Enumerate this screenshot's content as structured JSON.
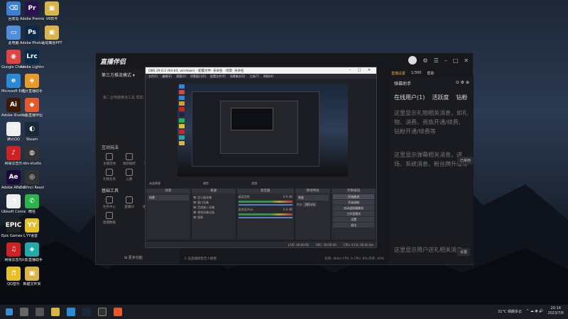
{
  "desktop": {
    "icons": [
      {
        "label": "回收站",
        "color": "#3d7fd1",
        "glyph": "⌫"
      },
      {
        "label": "Adobe Premie...",
        "color": "#2a1150",
        "glyph": "Pr"
      },
      {
        "label": "V6软件",
        "color": "#d9b44a",
        "glyph": "▣"
      },
      {
        "label": "此电脑",
        "color": "#4f8cd9",
        "glyph": "▭"
      },
      {
        "label": "Adobe Photosh...",
        "color": "#0a2a47",
        "glyph": "Ps"
      },
      {
        "label": "活动策划PPT",
        "color": "#d9b44a",
        "glyph": "▣"
      },
      {
        "label": "Google Chrome",
        "color": "#d44",
        "glyph": "◉"
      },
      {
        "label": "Adobe Lightro...",
        "color": "#0a2a47",
        "glyph": "Lrc"
      },
      {
        "label": "Microsoft Edge",
        "color": "#2a8ad4",
        "glyph": "e"
      },
      {
        "label": "虎牙直播助手",
        "color": "#e59a2a",
        "glyph": "◈"
      },
      {
        "label": "Adobe Illustrat...",
        "color": "#3a1a05",
        "glyph": "Ai"
      },
      {
        "label": "斗鱼直播伴侣",
        "color": "#e55a2a",
        "glyph": "◆"
      },
      {
        "label": "腾讯QQ",
        "color": "#eee",
        "glyph": "☺"
      },
      {
        "label": "Steam",
        "color": "#1b2838",
        "glyph": "◐"
      },
      {
        "label": "网易云音乐",
        "color": "#c22",
        "glyph": "♪"
      },
      {
        "label": "obs-studio",
        "color": "#333",
        "glyph": "◍"
      },
      {
        "label": "Adobe After Effects CC",
        "color": "#1a0a3a",
        "glyph": "Ae"
      },
      {
        "label": "DaVinci Resolve",
        "color": "#333",
        "glyph": "◎"
      },
      {
        "label": "Ubisoft Connect",
        "color": "#eee",
        "glyph": "◔"
      },
      {
        "label": "微信",
        "color": "#2bb34a",
        "glyph": "✆"
      },
      {
        "label": "Epic Games Launcher",
        "color": "#222",
        "glyph": "EPIC"
      },
      {
        "label": "YY语音",
        "color": "#e5c02a",
        "glyph": "YY"
      },
      {
        "label": "网易云音乐",
        "color": "#c22",
        "glyph": "♫"
      },
      {
        "label": "火影直播助手",
        "color": "#2aa",
        "glyph": "◈"
      },
      {
        "label": "QQ音乐",
        "color": "#e5c02a",
        "glyph": "♬"
      },
      {
        "label": "新建文件夹",
        "color": "#d9b44a",
        "glyph": "▣"
      }
    ]
  },
  "app": {
    "logo": "直播伴侣",
    "mode_label": "第三方推流模式 ▾",
    "left_note": "第二台电脑推流工具 帮助...",
    "top_links": [
      "直播设置",
      "1/300",
      "帮助"
    ],
    "section_interact": "互动玩法",
    "interact_tools": [
      "主播连线",
      "福袋抽奖",
      "粉丝团",
      "礼物任务",
      "心愿",
      "红包"
    ],
    "section_basic": "基础工具",
    "basic_tools": [
      "任务中心",
      "直播间",
      "弹幕助手",
      "直播数据"
    ],
    "more_label": "更多功能",
    "status_left": "① 该直播間暂无人觀看",
    "status_right": [
      "码率: 0kb/s",
      "FPS: 0",
      "CPU: 8%",
      "内存: 40%"
    ]
  },
  "right_panel": {
    "title": "弹幕助手",
    "tabs": [
      "在线用户(1)",
      "活跃度",
      "钻粉"
    ],
    "msg1": "这里显示礼物相关消息，如礼物、消费、贵族开通/续费、钻粉开通/续费等",
    "msg2": "这里显示弹幕相关消息，进场、系统消息、粉丝牌升级等",
    "msg3": "这里显示用户送礼相关消息",
    "chip1": "已禁用",
    "chip2": "设置"
  },
  "obs": {
    "title": "OBS 29.0.2 (64-bit, windows) - 配置文件: 未命名 - 场景: 未命名",
    "menu": [
      "文件(F)",
      "编辑(E)",
      "视图(V)",
      "停靠窗口(D)",
      "配置文件(P)",
      "场景集合(S)",
      "工具(T)",
      "帮助(H)"
    ],
    "src_bar_left": "未选择源",
    "src_bar_props": "属性",
    "src_bar_filter": "滤镜",
    "docks": [
      {
        "header": "场景",
        "items": [
          "场景"
        ]
      },
      {
        "header": "来源",
        "items": [
          "显示器采集",
          "窗口采集",
          "音频输入采集",
          "视频采集设备",
          "图像"
        ]
      },
      {
        "header": "混音器",
        "items": [
          "桌面音频",
          "麦克风/Aux"
        ]
      },
      {
        "header": "转场特效",
        "items": [
          "渐变",
          "时长",
          "300 ms"
        ]
      },
      {
        "header": "控制按钮",
        "items": [
          "开始推流",
          "开始录制",
          "启动虚拟摄像机",
          "工作室模式",
          "设置",
          "退出"
        ]
      }
    ],
    "mixer_db": [
      "0.0 dB",
      "0.0 dB"
    ],
    "status": [
      "LIVE: 00:00:00",
      "REC: 00:00:00",
      "CPU: 4.1%, 60.00 fps"
    ]
  },
  "taskbar": {
    "weather": "31°C 晴朗多云",
    "time": "20:14",
    "date": "2023/7/6"
  }
}
